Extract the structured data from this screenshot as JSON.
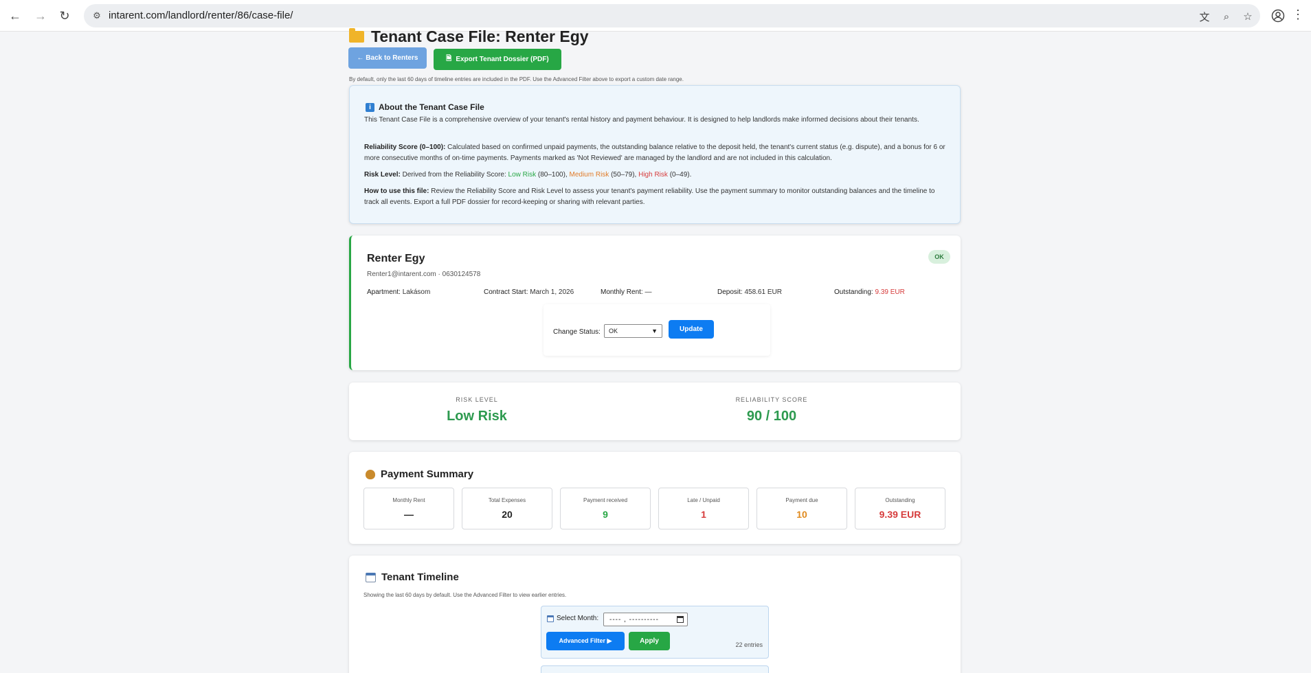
{
  "browser": {
    "url": "intarent.com/landlord/renter/86/case-file/"
  },
  "page": {
    "title": "Tenant Case File: Renter Egy",
    "back_button": "← Back to Renters",
    "export_button": "Export Tenant Dossier (PDF)",
    "pdf_note": "By default, only the last 60 days of timeline entries are included in the PDF. Use the Advanced Filter above to export a custom date range."
  },
  "about": {
    "title": "About the Tenant Case File",
    "intro": "This Tenant Case File is a comprehensive overview of your tenant's rental history and payment behaviour. It is designed to help landlords make informed decisions about their tenants.",
    "reliability_label": "Reliability Score (0–100):",
    "reliability_text": "Calculated based on confirmed unpaid payments, the outstanding balance relative to the deposit held, the tenant's current status (e.g. dispute), and a bonus for 6 or more consecutive months of on-time payments. Payments marked as 'Not Reviewed' are managed by the landlord and are not included in this calculation.",
    "risk_label": "Risk Level:",
    "risk_text_prefix": "Derived from the Reliability Score:",
    "low_risk": "Low Risk",
    "low_range": "(80–100),",
    "medium_risk": "Medium Risk",
    "medium_range": "(50–79),",
    "high_risk": "High Risk",
    "high_range": "(0–49).",
    "howto_label": "How to use this file:",
    "howto_text": "Review the Reliability Score and Risk Level to assess your tenant's payment reliability. Use the payment summary to monitor outstanding balances and the timeline to track all events. Export a full PDF dossier for record-keeping or sharing with relevant parties."
  },
  "tenant": {
    "name": "Renter Egy",
    "contact": "Renter1@intarent.com · 0630124578",
    "status_badge": "OK",
    "apartment_label": "Apartment:",
    "apartment": "Lakásom",
    "contract_label": "Contract Start:",
    "contract_start": "March 1, 2026",
    "rent_label": "Monthly Rent:",
    "rent": "—",
    "deposit_label": "Deposit:",
    "deposit": "458.61 EUR",
    "outstanding_label": "Outstanding:",
    "outstanding": "9.39 EUR",
    "change_status_label": "Change Status:",
    "status_value": "OK",
    "update_button": "Update"
  },
  "risk": {
    "risk_level_label": "RISK LEVEL",
    "risk_level": "Low Risk",
    "score_label": "RELIABILITY SCORE",
    "score": "90 / 100"
  },
  "payment_summary": {
    "title": "Payment Summary",
    "tiles": [
      {
        "label": "Monthly Rent",
        "value": "—",
        "color": "#222222"
      },
      {
        "label": "Total Expenses",
        "value": "20",
        "color": "#222222"
      },
      {
        "label": "Payment received",
        "value": "9",
        "color": "#28a745"
      },
      {
        "label": "Late / Unpaid",
        "value": "1",
        "color": "#d63b3b"
      },
      {
        "label": "Payment due",
        "value": "10",
        "color": "#e08a1e"
      },
      {
        "label": "Outstanding",
        "value": "9.39 EUR",
        "color": "#d63b3b"
      }
    ]
  },
  "timeline": {
    "title": "Tenant Timeline",
    "note": "Showing the last 60 days by default. Use the Advanced Filter to view earlier entries.",
    "select_month_label": "Select Month:",
    "month_value": "---- , ----------",
    "advanced_filter_button": "Advanced Filter ▶",
    "apply_button": "Apply",
    "entries": "22 entries"
  },
  "colors": {
    "accent_blue": "#0d7cf2",
    "green": "#28a745",
    "orange": "#e07b28",
    "red": "#d63b3b"
  }
}
